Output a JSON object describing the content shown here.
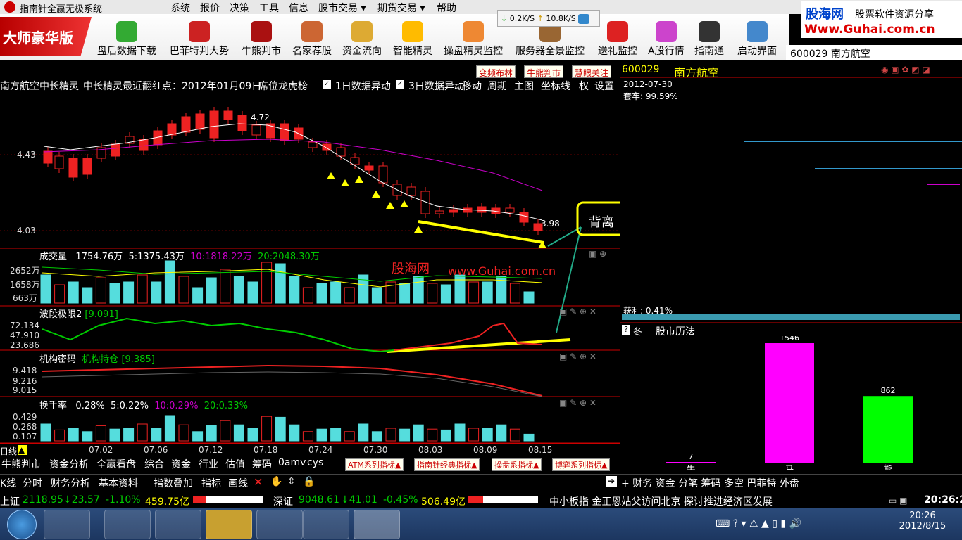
{
  "titlebar": {
    "title": "指南针全赢无极系统"
  },
  "menu": [
    "系统",
    "报价",
    "决策",
    "工具",
    "信息",
    "股市交易 ▾",
    "期货交易 ▾",
    "帮助"
  ],
  "brand": "大师豪华版",
  "speed": {
    "down": "0.2K/S",
    "up": "10.8K/S"
  },
  "toolbar": [
    "盘后数据下载",
    "巴菲特判大势",
    "牛熊判市",
    "名家荐股",
    "资金流向",
    "智能精灵",
    "操盘精灵监控",
    "服务器全景监控",
    "送礼监控",
    "A股行情",
    "指南通",
    "启动界面"
  ],
  "ad": {
    "logo": "股海网",
    "slogan": "股票软件资源分享",
    "url": "Www.Guhai.com.cn"
  },
  "stock_header": "600029 南方航空",
  "top_buttons": [
    "变频布林",
    "牛熊判市",
    "慧眼关注"
  ],
  "infobar": {
    "name": "南方航空",
    "indicator": "中长精灵",
    "lastsignal": "中长精灵最近翻红点：2012年01月09日",
    "tiger": "席位龙虎榜",
    "opt1": "1日数据异动",
    "opt2": "3日数据异动",
    "right": [
      "移动",
      "周期",
      "主图",
      "坐标线",
      "权",
      "设置"
    ]
  },
  "price_axis": {
    "high": "4.43",
    "low": "4.03",
    "max_label": "4.72",
    "min_label": "3.98"
  },
  "annotation": "背离",
  "volume": {
    "title": "成交量",
    "v": "1754.76万",
    "ma5": "5:1375.43万",
    "ma10": "10:1818.22万",
    "ma20": "20:2048.30万",
    "ticks": [
      "2652万",
      "1658万",
      "663万"
    ]
  },
  "watermark": {
    "cn": "股海网",
    "url": "www.Guhai.com.cn"
  },
  "band": {
    "title": "波段极限2",
    "val": "[9.091]",
    "ticks": [
      "72.134",
      "47.910",
      "23.686"
    ]
  },
  "inst": {
    "title": "机构密码",
    "sub": "机构持仓",
    "val": "[9.385]",
    "ticks": [
      "9.418",
      "9.216",
      "9.015"
    ]
  },
  "turnover": {
    "title": "换手率",
    "v": "0.28%",
    "ma5": "5:0.22%",
    "ma10": "10:0.29%",
    "ma20": "20:0.33%",
    "ticks": [
      "0.429",
      "0.268",
      "0.107"
    ]
  },
  "xaxis": {
    "label": "日线",
    "dates": [
      "07.02",
      "07.06",
      "07.12",
      "07.18",
      "07.24",
      "07.30",
      "08.03",
      "08.09",
      "08.15"
    ]
  },
  "right": {
    "code": "600029",
    "name": "南方航空",
    "date": "2012-07-30",
    "trap": "套牢: 99.59%",
    "profit": "获利: 0.41%",
    "history_title": "股市历法",
    "season": "冬"
  },
  "chart_data": {
    "type": "bar",
    "categories": [
      "牛",
      "马",
      "熊"
    ],
    "values": [
      7,
      1546,
      862
    ],
    "colors": [
      "#ff00ff",
      "#ff00ff",
      "#00ff00"
    ]
  },
  "bottom_tabs": [
    "牛熊判市",
    "资金分析",
    "全赢看盘",
    "综合",
    "资金",
    "行业",
    "估值",
    "筹码",
    "0amv",
    "cys"
  ],
  "indicator_tabs": [
    "ATM系列指标▲",
    "指南针经典指标▲",
    "操盘系指标▲",
    "博弈系列指标▲"
  ],
  "bottom_tabs2": [
    "K线",
    "分时",
    "财务分析",
    "基本资料",
    "指数叠加",
    "指标",
    "画线"
  ],
  "bottom_right": "+ 财务 资金 分笔 筹码 多空 巴菲特 外盘",
  "ticker": {
    "sh_label": "上证",
    "sh": "2118.95",
    "sh_chg": "↓23.57",
    "sh_pct": "-1.10%",
    "sh_amt": "459.75亿",
    "sz_label": "深证",
    "sz": "9048.61",
    "sz_chg": "↓41.01",
    "sz_pct": "-0.45%",
    "sz_amt": "506.49亿",
    "news": "中小板指  金正恩姑父访问北京 探讨推进经济区发展",
    "time": "20:26:20"
  },
  "clock": {
    "time": "20:26",
    "date": "2012/8/15"
  }
}
